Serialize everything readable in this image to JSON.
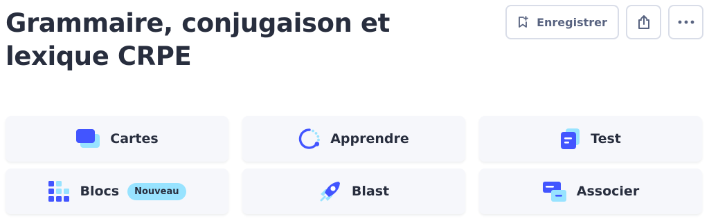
{
  "set": {
    "title": "Grammaire, conjugaison et lexique CRPE"
  },
  "actions": {
    "save_label": "Enregistrer",
    "save_icon": "bookmark-plus-icon",
    "share_icon": "share-icon",
    "more_icon": "more-horizontal-icon"
  },
  "modes": [
    {
      "label": "Cartes",
      "icon": "flashcards-icon"
    },
    {
      "label": "Apprendre",
      "icon": "learn-icon"
    },
    {
      "label": "Test",
      "icon": "test-icon"
    },
    {
      "label": "Blocs",
      "icon": "blocks-icon",
      "badge": "Nouveau"
    },
    {
      "label": "Blast",
      "icon": "blast-rocket-icon"
    },
    {
      "label": "Associer",
      "icon": "match-icon"
    }
  ],
  "colors": {
    "primary": "#4255ff",
    "light_blue": "#98e3ff",
    "tile_bg": "#f6f7fb",
    "text": "#282e3e",
    "muted": "#586380"
  }
}
